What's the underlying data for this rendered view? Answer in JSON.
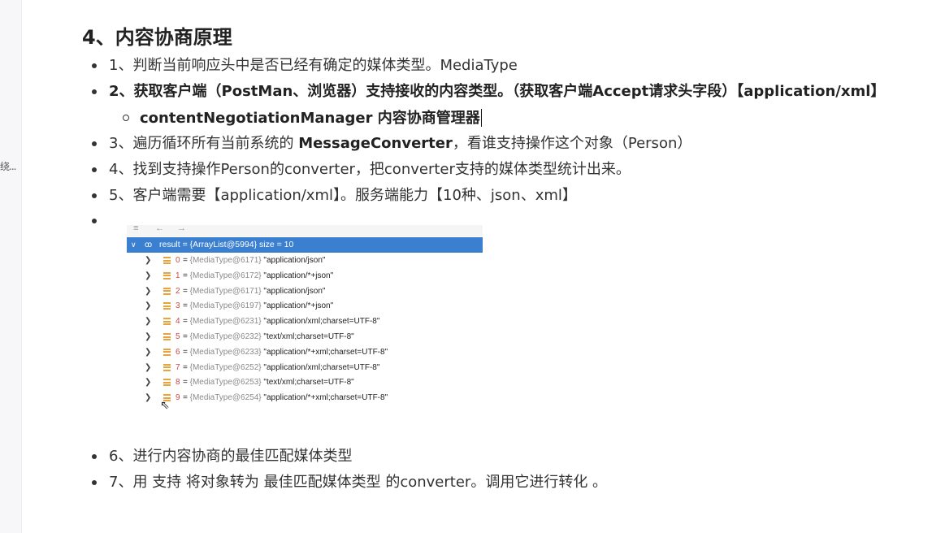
{
  "left_rail": {
    "truncated_text": "绕..."
  },
  "heading": "4、内容协商原理",
  "items": [
    {
      "text": "1、判断当前响应头中是否已经有确定的媒体类型。MediaType"
    },
    {
      "text": "2、获取客户端（PostMan、浏览器）支持接收的内容类型。（获取客户端Accept请求头字段）【application/xml】"
    },
    {
      "sub_text": "contentNegotiationManager 内容协商管理器"
    },
    {
      "prefix": "3、遍历循环所有当前系统的 ",
      "bold": "MessageConverter",
      "suffix": "，看谁支持操作这个对象（Person）"
    },
    {
      "text": "4、找到支持操作Person的converter，把converter支持的媒体类型统计出来。"
    },
    {
      "text": "5、客户端需要【application/xml】。服务端能力【10种、json、xml】"
    },
    {
      "text": "6、进行内容协商的最佳匹配媒体类型"
    },
    {
      "text": "7、用 支持 将对象转为 最佳匹配媒体类型 的converter。调用它进行转化 。"
    }
  ],
  "debugger": {
    "toolbar_icons": [
      "list-icon",
      "back-arrow-icon",
      "forward-arrow-icon"
    ],
    "result_label": "result = {ArrayList@5994}  size = 10",
    "entries": [
      {
        "index": "0",
        "ref": "{MediaType@6171}",
        "value": "\"application/json\""
      },
      {
        "index": "1",
        "ref": "{MediaType@6172}",
        "value": "\"application/*+json\""
      },
      {
        "index": "2",
        "ref": "{MediaType@6171}",
        "value": "\"application/json\""
      },
      {
        "index": "3",
        "ref": "{MediaType@6197}",
        "value": "\"application/*+json\""
      },
      {
        "index": "4",
        "ref": "{MediaType@6231}",
        "value": "\"application/xml;charset=UTF-8\""
      },
      {
        "index": "5",
        "ref": "{MediaType@6232}",
        "value": "\"text/xml;charset=UTF-8\""
      },
      {
        "index": "6",
        "ref": "{MediaType@6233}",
        "value": "\"application/*+xml;charset=UTF-8\""
      },
      {
        "index": "7",
        "ref": "{MediaType@6252}",
        "value": "\"application/xml;charset=UTF-8\""
      },
      {
        "index": "8",
        "ref": "{MediaType@6253}",
        "value": "\"text/xml;charset=UTF-8\""
      },
      {
        "index": "9",
        "ref": "{MediaType@6254}",
        "value": "\"application/*+xml;charset=UTF-8\""
      }
    ]
  },
  "colors": {
    "selection": "#3a7fd0",
    "index": "#c94b46",
    "list_icon": "#e8a33d"
  }
}
